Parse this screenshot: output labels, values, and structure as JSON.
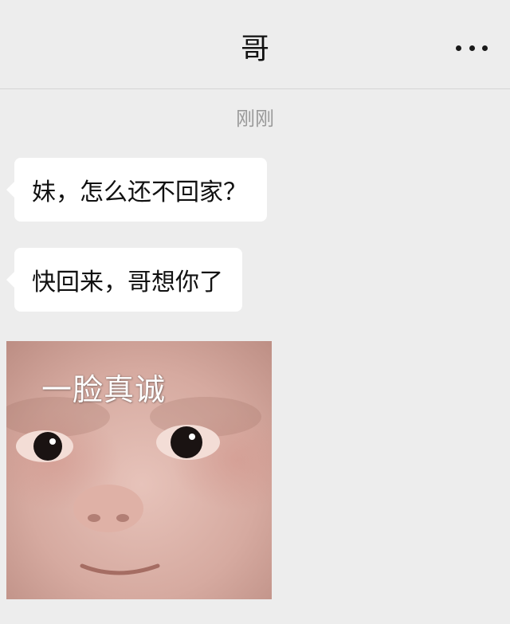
{
  "header": {
    "title": "哥",
    "more_icon": "more-dots-icon"
  },
  "chat": {
    "timestamp": "刚刚",
    "messages": [
      {
        "type": "text",
        "sender": "contact",
        "text": "妹，怎么还不回家？"
      },
      {
        "type": "text",
        "sender": "contact",
        "text": "快回来，哥想你了"
      },
      {
        "type": "sticker",
        "sender": "contact",
        "caption": "一脸真诚"
      }
    ]
  },
  "colors": {
    "background": "#ededed",
    "bubble": "#ffffff",
    "timestamp": "#9a9a9a"
  }
}
